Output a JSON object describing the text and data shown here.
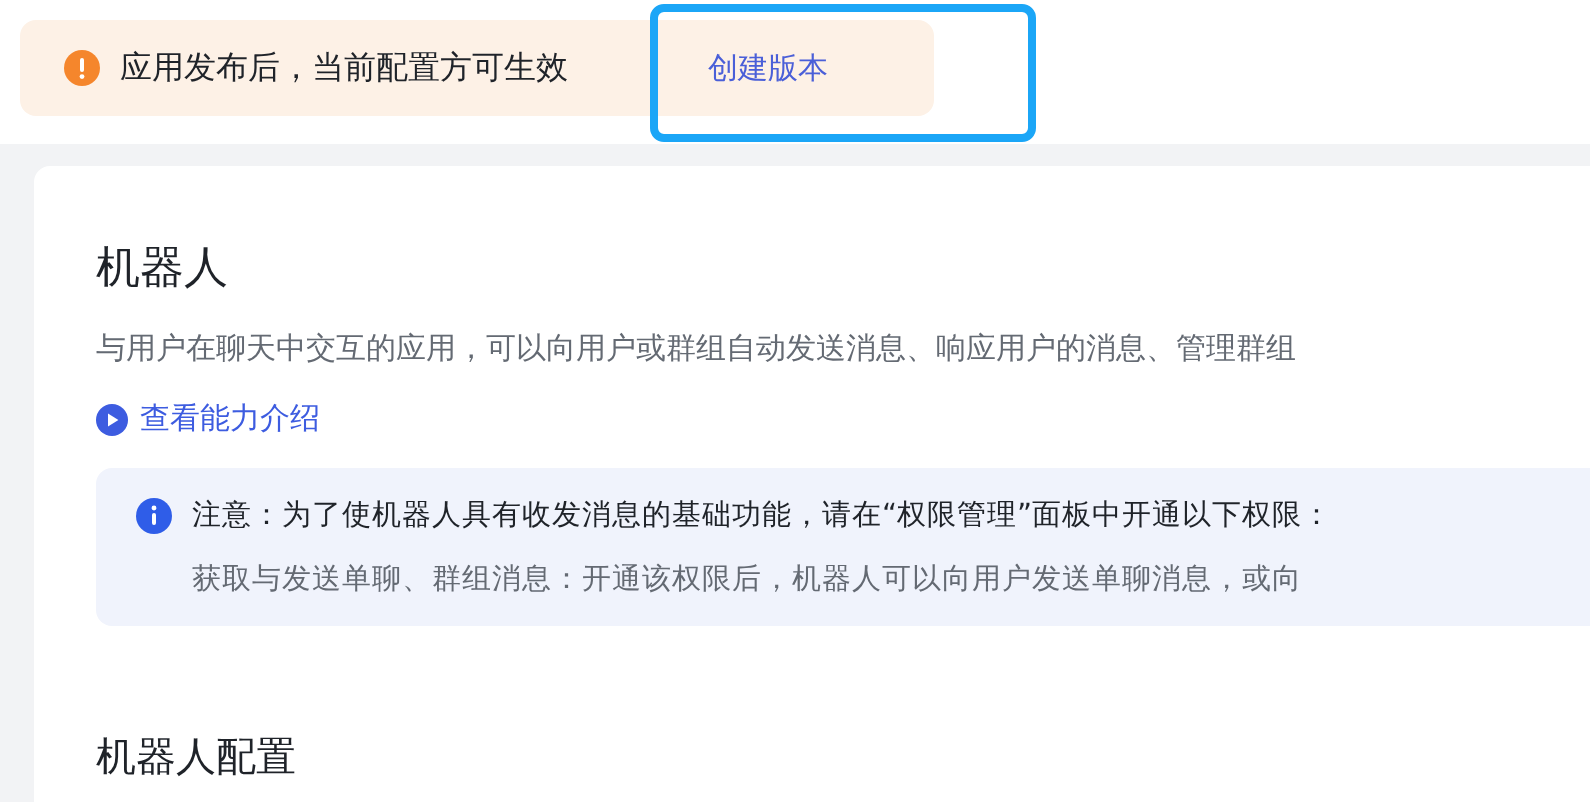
{
  "banner": {
    "message": "应用发布后，当前配置方可生效",
    "action": "创建版本"
  },
  "section": {
    "title": "机器人",
    "description": "与用户在聊天中交互的应用，可以向用户或群组自动发送消息、响应用户的消息、管理群组",
    "link": "查看能力介绍",
    "notice": {
      "title": "注意：为了使机器人具有收发消息的基础功能，请在“权限管理”面板中开通以下权限：",
      "detail": "获取与发送单聊、群组消息：开通该权限后，机器人可以向用户发送单聊消息，或向"
    }
  },
  "next_section": {
    "title": "机器人配置"
  }
}
